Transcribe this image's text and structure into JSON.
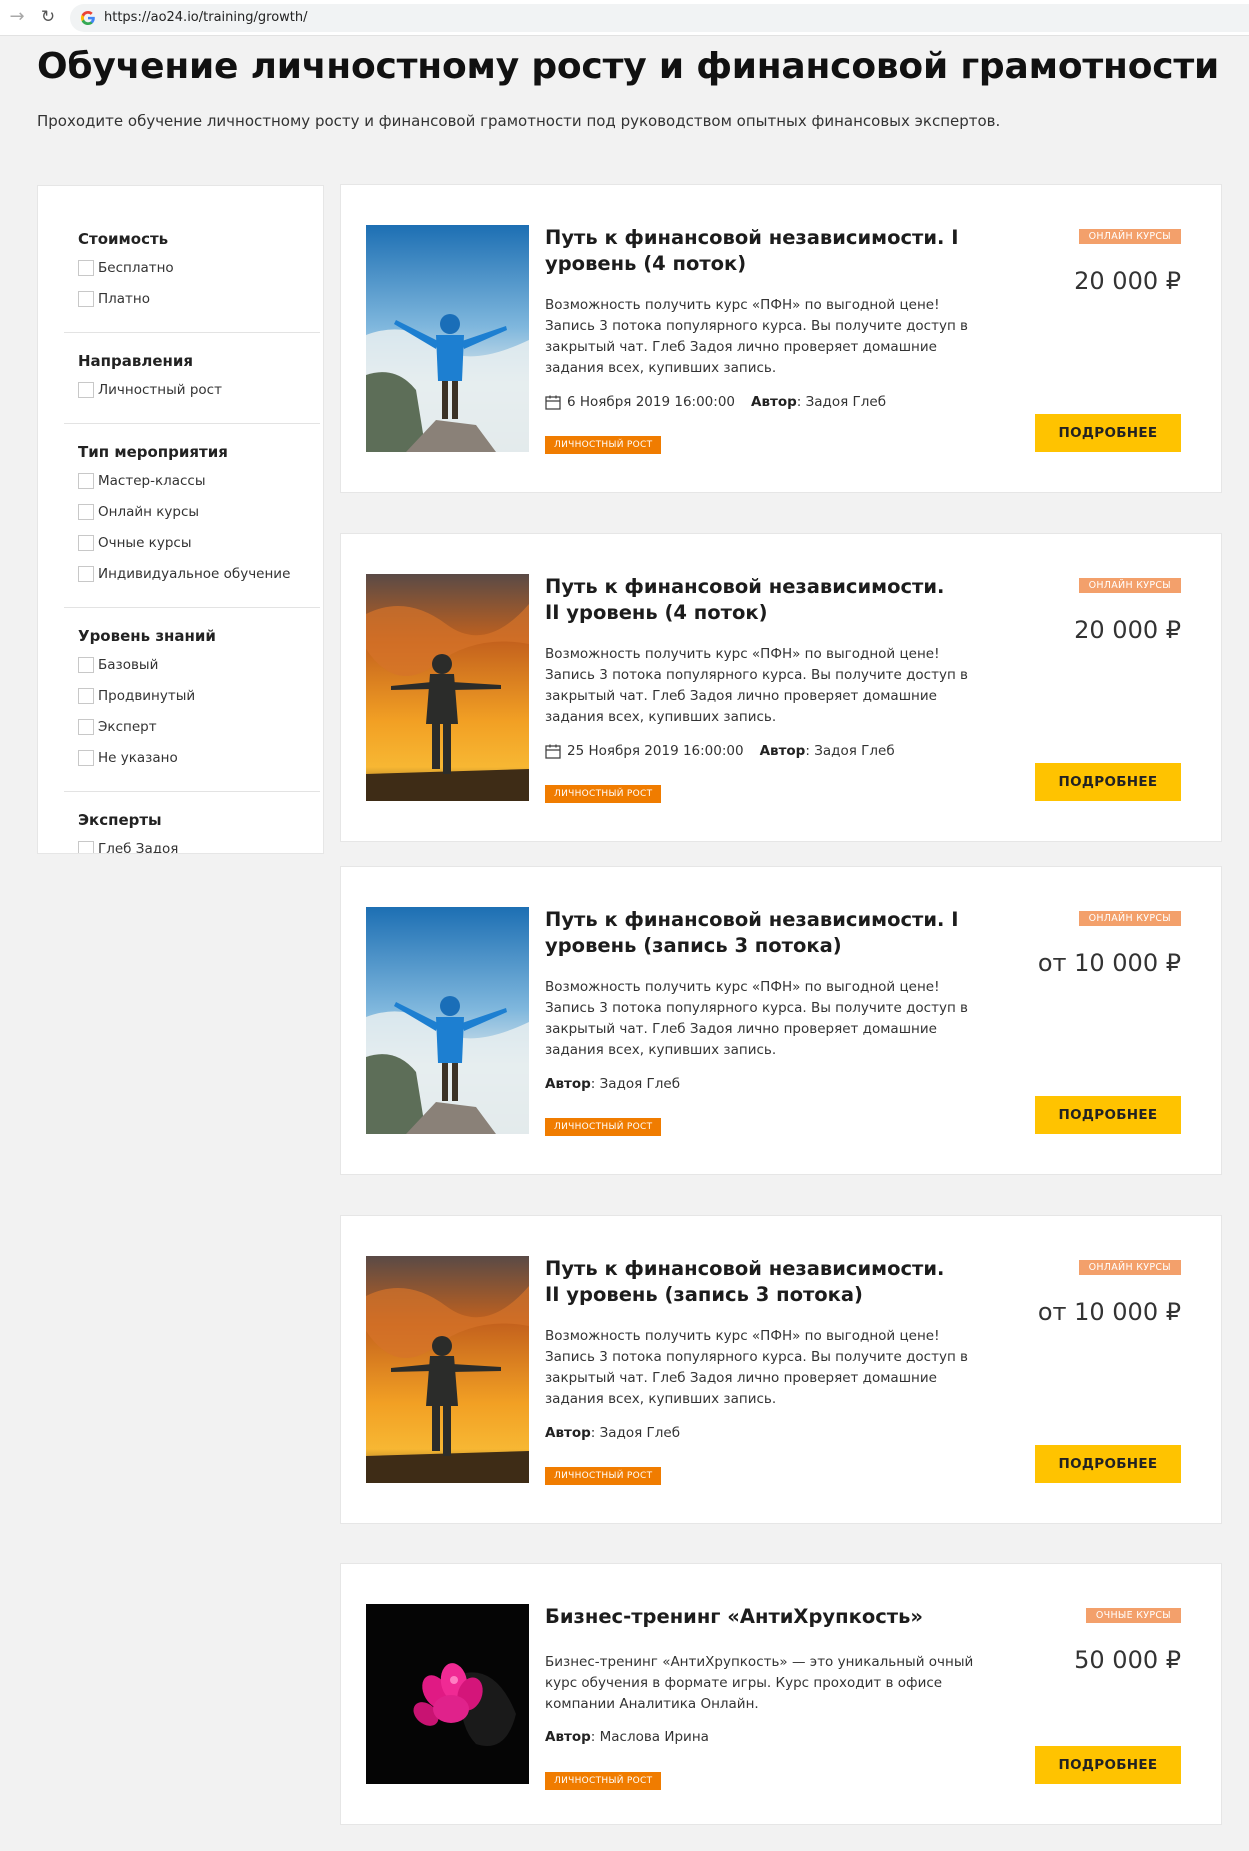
{
  "browser": {
    "url": "https://ao24.io/training/growth/"
  },
  "header": {
    "title": "Обучение личностному росту и финансовой грамотности",
    "lead": "Проходите обучение личностному росту и финансовой грамотности под руководством опытных финансовых экспертов."
  },
  "filters": [
    {
      "title": "Стоимость",
      "options": [
        "Бесплатно",
        "Платно"
      ]
    },
    {
      "title": "Направления",
      "options": [
        "Личностный рост"
      ]
    },
    {
      "title": "Тип мероприятия",
      "options": [
        "Мастер-классы",
        "Онлайн курсы",
        "Очные курсы",
        "Индивидуальное обучение"
      ]
    },
    {
      "title": "Уровень знаний",
      "options": [
        "Базовый",
        "Продвинутый",
        "Эксперт",
        "Не указано"
      ]
    },
    {
      "title": "Эксперты",
      "options": [
        "Глеб Задоя"
      ]
    }
  ],
  "author_label": "Автор",
  "colon": ":",
  "courses": [
    {
      "title": "Путь к финансовой независимости. I уровень (4 поток)",
      "type": "ОНЛАЙН КУРСЫ",
      "price": "20 000 ₽",
      "desc": "Возможность получить курс «ПФН» по выгодной цене! Запись 3 потока популярного курса. Вы получите доступ в закрытый чат. Глеб Задоя лично проверяет домашние задания всех, купивших запись.",
      "date": "6 Ноября 2019 16:00:00",
      "author": "Задоя Глеб",
      "tag": "ЛИЧНОСТНЫЙ РОСТ",
      "button": "ПОДРОБНЕЕ",
      "image": "mountain-hiker"
    },
    {
      "title": "Путь к финансовой независимости. II уровень (4 поток)",
      "type": "ОНЛАЙН КУРСЫ",
      "price": "20 000 ₽",
      "desc": "Возможность получить курс «ПФН» по выгодной цене! Запись 3 потока популярного курса. Вы получите доступ в закрытый чат. Глеб Задоя лично проверяет домашние задания всех, купивших запись.",
      "date": "25 Ноября 2019 16:00:00",
      "author": "Задоя Глеб",
      "tag": "ЛИЧНОСТНЫЙ РОСТ",
      "button": "ПОДРОБНЕЕ",
      "image": "sunset-woman"
    },
    {
      "title": "Путь к финансовой независимости. I уровень (запись 3 потока)",
      "type": "ОНЛАЙН КУРСЫ",
      "price": "от 10 000 ₽",
      "desc": "Возможность получить курс «ПФН» по выгодной цене! Запись 3 потока популярного курса. Вы получите доступ в закрытый чат. Глеб Задоя лично проверяет домашние задания всех, купивших запись.",
      "author": "Задоя Глеб",
      "tag": "ЛИЧНОСТНЫЙ РОСТ",
      "button": "ПОДРОБНЕЕ",
      "image": "mountain-hiker"
    },
    {
      "title": "Путь к финансовой независимости. II уровень (запись 3 потока)",
      "type": "ОНЛАЙН КУРСЫ",
      "price": "от 10 000 ₽",
      "desc": "Возможность получить курс «ПФН» по выгодной цене! Запись 3 потока популярного курса. Вы получите доступ в закрытый чат. Глеб Задоя лично проверяет домашние задания всех, купивших запись.",
      "author": "Задоя Глеб",
      "tag": "ЛИЧНОСТНЫЙ РОСТ",
      "button": "ПОДРОБНЕЕ",
      "image": "sunset-woman"
    },
    {
      "title": "Бизнес-тренинг «АнтиХрупкость»",
      "type": "ОЧНЫЕ КУРСЫ",
      "price": "50 000 ₽",
      "desc": "Бизнес-тренинг «АнтиХрупкость» — это уникальный очный курс обучения в формате игры. Курс проходит в офисе компании Аналитика Онлайн.",
      "author": "Маслова Ирина",
      "tag": "ЛИЧНОСТНЫЙ РОСТ",
      "button": "ПОДРОБНЕЕ",
      "image": "pink-glove"
    }
  ]
}
